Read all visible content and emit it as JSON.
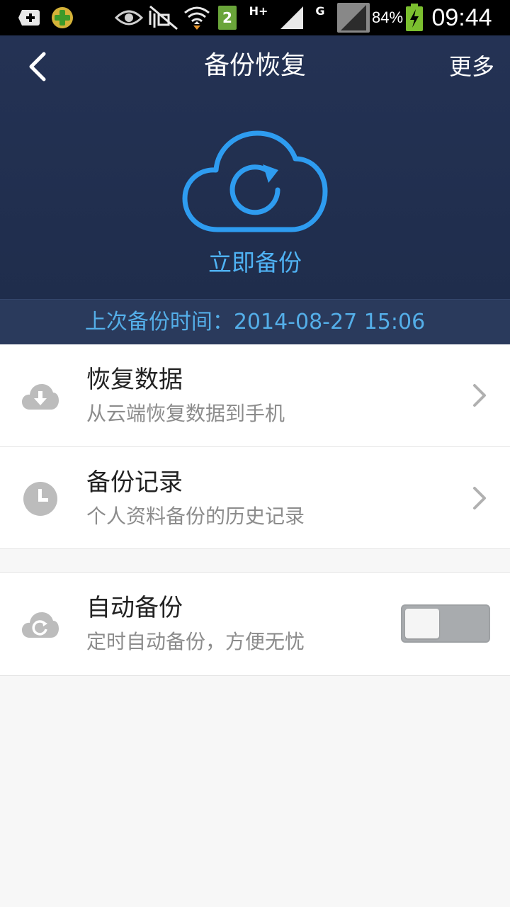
{
  "status_bar": {
    "notification_icons": [
      "add-square-icon",
      "plus-badge-icon",
      "eye-icon",
      "mute-icon",
      "wifi-icon",
      "sim-2-icon"
    ],
    "sim_badge": "2",
    "network_type_1": "H+",
    "network_type_2": "G",
    "battery_percent": "84%",
    "time": "09:44"
  },
  "header": {
    "title": "备份恢复",
    "more_label": "更多",
    "backup_now_label": "立即备份"
  },
  "last_backup": {
    "text": "上次备份时间：2014-08-27 15:06"
  },
  "menu": {
    "restore": {
      "title": "恢复数据",
      "subtitle": "从云端恢复数据到手机"
    },
    "history": {
      "title": "备份记录",
      "subtitle": "个人资料备份的历史记录"
    },
    "auto_backup": {
      "title": "自动备份",
      "subtitle": "定时自动备份，方便无忧",
      "enabled": false
    }
  },
  "colors": {
    "header_bg": "#243254",
    "accent_blue": "#4fb2f3",
    "last_backup_text": "#54aee8",
    "icon_gray": "#bcbcbc"
  }
}
